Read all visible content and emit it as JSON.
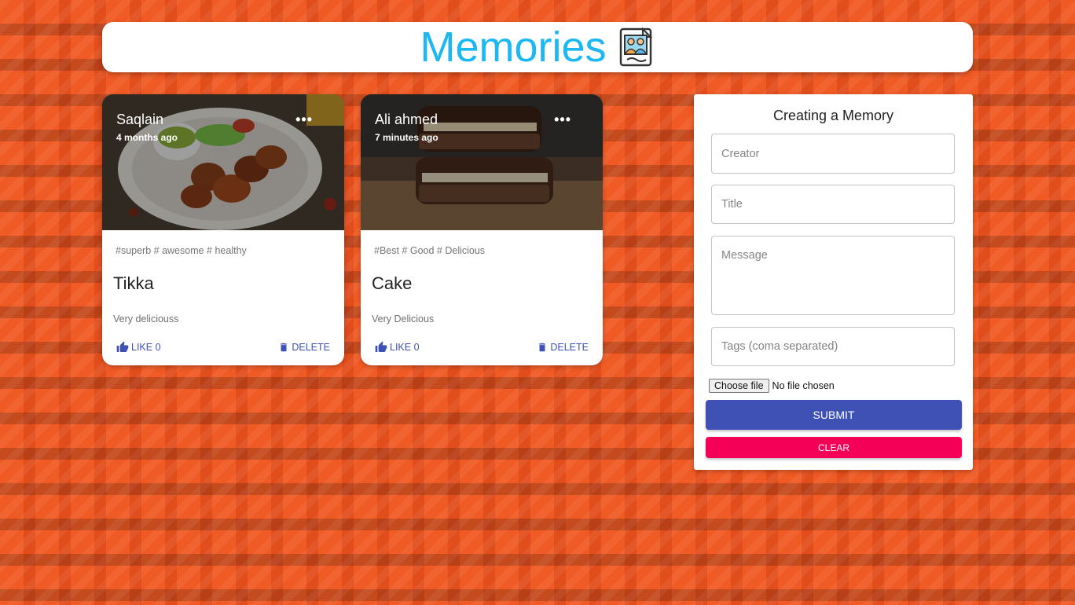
{
  "app": {
    "title": "Memories",
    "logo_icon": "photo-memories-icon",
    "title_color": "#1db8f2"
  },
  "posts": [
    {
      "creator": "Saqlain",
      "time": "4 months ago",
      "tags": "#superb # awesome # healthy",
      "title": "Tikka",
      "message": "Very deliciouss",
      "like_label": "LIKE 0",
      "delete_label": "DELETE",
      "more_label": "•••",
      "image_icon": "chicken-tikka-plate-image"
    },
    {
      "creator": "Ali ahmed",
      "time": "7 minutes ago",
      "tags": "#Best # Good # Delicious",
      "title": "Cake",
      "message": "Very Delicious",
      "like_label": "LIKE 0",
      "delete_label": "DELETE",
      "more_label": "•••",
      "image_icon": "chocolate-cake-image"
    }
  ],
  "form": {
    "title": "Creating a Memory",
    "creator_placeholder": "Creator",
    "title_placeholder": "Title",
    "message_placeholder": "Message",
    "tags_placeholder": "Tags (coma separated)",
    "file_button_label": "Choose file",
    "file_status": "No file chosen",
    "submit_label": "SUBMIT",
    "clear_label": "CLEAR"
  },
  "colors": {
    "primary": "#3f51b5",
    "secondary": "#f50057",
    "background": "#ee5522"
  }
}
